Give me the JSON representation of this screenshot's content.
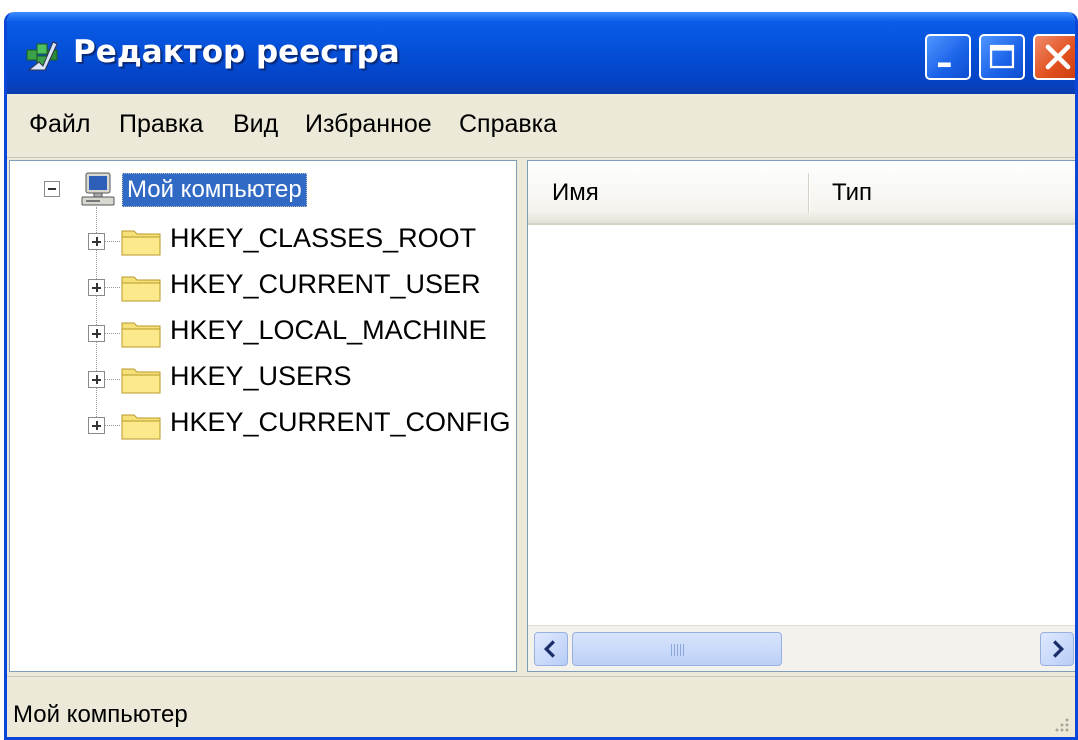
{
  "window": {
    "title": "Редактор реестра"
  },
  "menu": {
    "items": [
      "Файл",
      "Правка",
      "Вид",
      "Избранное",
      "Справка"
    ]
  },
  "tree": {
    "root_label": "Мой компьютер",
    "keys": [
      "HKEY_CLASSES_ROOT",
      "HKEY_CURRENT_USER",
      "HKEY_LOCAL_MACHINE",
      "HKEY_USERS",
      "HKEY_CURRENT_CONFIG"
    ]
  },
  "list": {
    "columns": [
      "Имя",
      "Тип"
    ]
  },
  "status": {
    "text": "Мой компьютер"
  },
  "icons": {
    "app": "registry-editor-icon",
    "minimize": "minimize-icon",
    "maximize": "maximize-icon",
    "close": "close-icon",
    "computer": "computer-icon",
    "folder": "folder-icon",
    "expand": "plus-box-icon",
    "collapse": "minus-box-icon",
    "scroll_left": "chevron-left-icon",
    "scroll_right": "chevron-right-icon",
    "size_grip": "resize-grip-icon"
  },
  "colors": {
    "titlebar": "#0550d8",
    "close_button": "#e2521f",
    "selection": "#316ac5",
    "chrome": "#ece9d8",
    "folder": "#f5e07a"
  }
}
